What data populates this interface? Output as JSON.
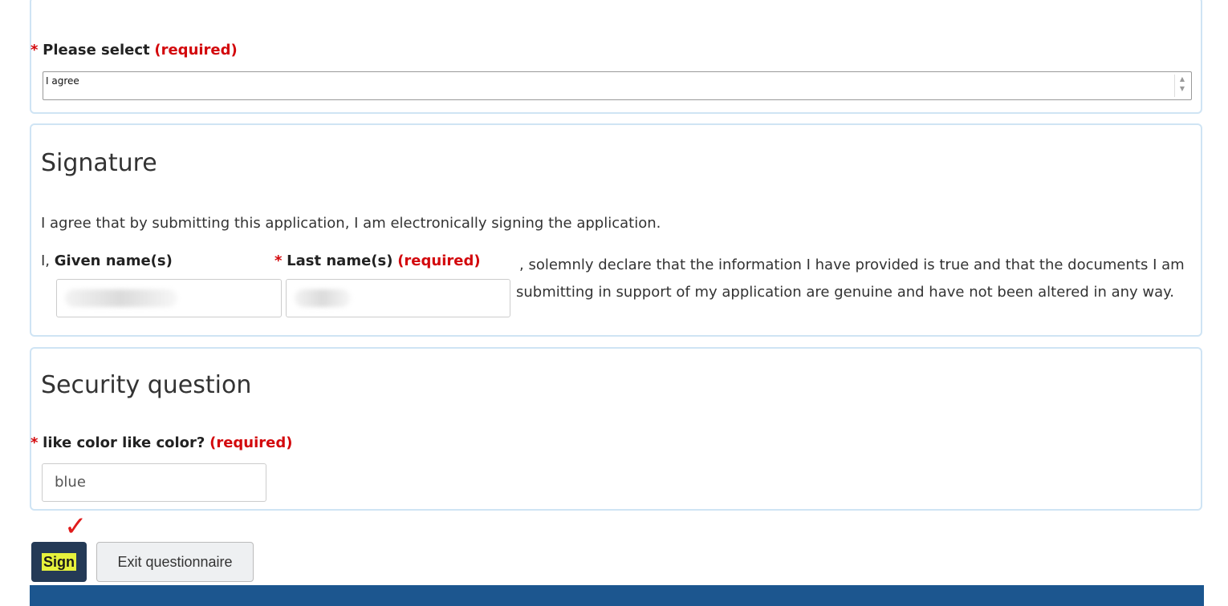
{
  "consent": {
    "star": "*",
    "label": "Please select",
    "required": "(required)",
    "selected_value": "I agree"
  },
  "signature": {
    "heading": "Signature",
    "statement": "I agree that by submitting this application, I am electronically signing the application.",
    "prefix": "I,",
    "given_label": "Given name(s)",
    "last_star": "*",
    "last_label": "Last name(s)",
    "last_required": "(required)",
    "declaration": ", solemnly declare that the information I have provided is true and that the documents I am submitting in support of my application are genuine and have not been altered in any way."
  },
  "security": {
    "heading": "Security question",
    "star": "*",
    "question": "like color like color?",
    "required": "(required)",
    "answer": "blue"
  },
  "actions": {
    "sign_label": "Sign",
    "exit_label": "Exit questionnaire",
    "checkmark": "✓"
  },
  "colors": {
    "required": "#d3080c",
    "panel_border": "#cfe4f4",
    "sign_button": "#243a56",
    "highlight": "#e6f23c",
    "footer": "#1c568f"
  }
}
